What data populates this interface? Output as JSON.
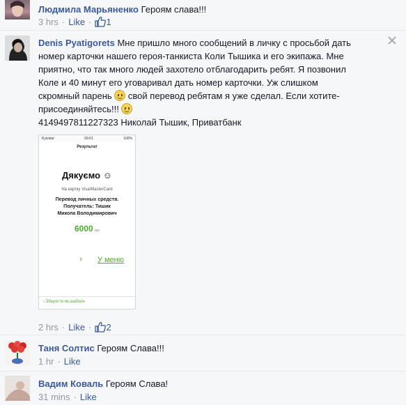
{
  "comments": [
    {
      "name": "Людмила Марьяненко",
      "text": "Героям слава!!!",
      "time": "3 hrs",
      "like_label": "Like",
      "like_count": "1"
    },
    {
      "name": "Denis Pyatigorets",
      "text_line1": "Мне пришло много сообщений в личку с просьбой дать",
      "text_line2": "номер карточки нашего героя-танкиста Коли Тышика и его экипажа. Мне",
      "text_line3": "приятно, что так много людей захотело отблагодарить ребят. Я позвонил",
      "text_line4": "Коле и 40 минут его уговаривал дать номер карточки. Уж слишком",
      "text_line5a": "скромный парень",
      "text_line5b": "свой перевод ребятам я уже сделал. Если хотите-",
      "text_line6": "присоединяйтесь!!!",
      "text_line7": "4149497811227323 Николай Тышик, Приватбанк",
      "time": "2 hrs",
      "like_label": "Like",
      "like_count": "2",
      "close_icon": "close-icon",
      "attachment": {
        "carrier": "Kyivstar",
        "clock": "09:01",
        "battery": "100%",
        "title": "Результат",
        "thanks": "Дякуємо ☺",
        "card_note": "На картку Visa/MasterCard",
        "desc_line1": "Перевод личных средств.",
        "desc_line2": "Получатель: Тишик",
        "desc_line3": "Микола Володимирович",
        "amount": "6000",
        "currency": "грн",
        "menu_arrow": "›",
        "menu_label": "У меню",
        "save_template": "› Зберегти як шаблон"
      }
    },
    {
      "name": "Таня Солтис",
      "text": "Героям Слава!!!",
      "time": "1 hr",
      "like_label": "Like"
    },
    {
      "name": "Вадим Коваль",
      "text": "Героям Слава!",
      "time": "31 mins",
      "like_label": "Like"
    }
  ],
  "separator": "·"
}
